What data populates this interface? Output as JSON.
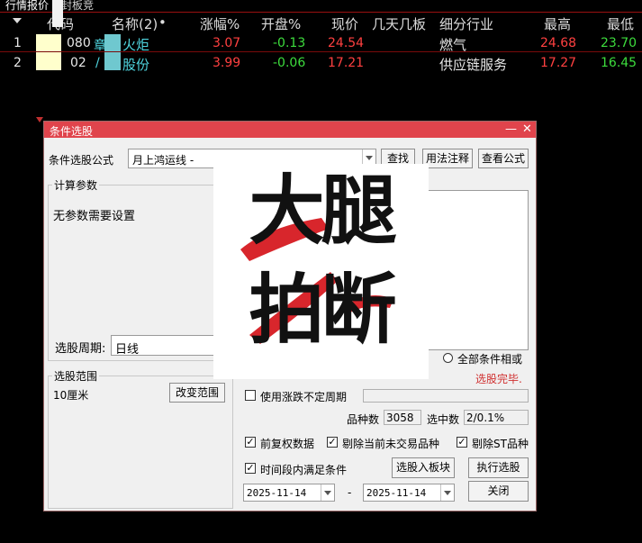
{
  "tabs": [
    {
      "label": "行情报价",
      "active": true
    },
    {
      "label": "封板竞"
    }
  ],
  "table": {
    "headers": {
      "code": "代码",
      "name": "名称(2)",
      "dot": "•",
      "change_pct": "涨幅%",
      "open_pct": "开盘%",
      "price": "现价",
      "streak": "几天几板",
      "industry": "细分行业",
      "high": "最高",
      "low": "最低"
    },
    "rows": [
      {
        "index": "1",
        "code": "080",
        "name": "火炬",
        "name_prefix": "章",
        "change_pct": "3.07",
        "open_pct": "-0.13",
        "price": "24.54",
        "industry": "燃气",
        "high": "24.68",
        "low": "23.70"
      },
      {
        "index": "2",
        "code": "02",
        "name": "股份",
        "name_prefix": "/",
        "change_pct": "3.99",
        "open_pct": "-0.06",
        "price": "17.21",
        "industry": "供应链服务",
        "high": "17.27",
        "low": "16.45"
      }
    ]
  },
  "dialog": {
    "title": "条件选股",
    "formula_label": "条件选股公式",
    "formula_value": "月上鸿运线  -",
    "btn_find": "查找",
    "btn_usage": "用法注释",
    "btn_view": "查看公式",
    "params_label": "计算参数",
    "params_text": "无参数需要设置",
    "period_label": "选股周期:",
    "period_value": "日线",
    "all_cond_label": "全部条件相或",
    "status": "选股完毕.",
    "range_label": "选股范围",
    "range_value": "10厘米",
    "btn_change_range": "改变范围",
    "use_period_label": "使用涨跌不定周期",
    "count_label": "品种数",
    "count_value": "3058",
    "selected_label": "选中数",
    "selected_value": "2/0.1%",
    "opt_prev_adj": "前复权数据",
    "opt_exclude_untraded": "剔除当前未交易品种",
    "opt_exclude_st": "剔除ST品种",
    "opt_time_period": "时间段内满足条件",
    "btn_to_block": "选股入板块",
    "btn_execute": "执行选股",
    "date_from": "2025-11-14",
    "date_sep": "-",
    "date_to": "2025-11-14",
    "btn_close": "关闭",
    "min_symbol": "—",
    "close_symbol": "✕"
  },
  "overlay": {
    "line1": "大腿",
    "line2": "拍断"
  },
  "colors": {
    "up": "#ff4040",
    "down": "#3ddc3d",
    "accent": "#e0444c"
  }
}
